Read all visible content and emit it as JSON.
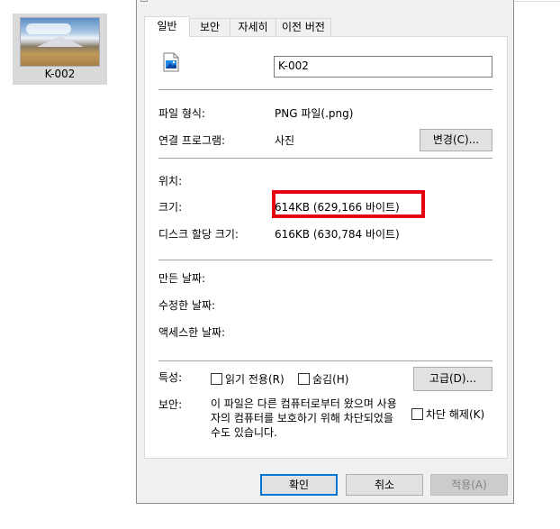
{
  "explorer": {
    "file_label": "K-002"
  },
  "tabs": [
    {
      "label": "일반",
      "active": true
    },
    {
      "label": "보안"
    },
    {
      "label": "자세히"
    },
    {
      "label": "이전 버전"
    }
  ],
  "general": {
    "file_name": "K-002",
    "file_type_label": "파일 형식:",
    "file_type_value": "PNG 파일(.png)",
    "opens_with_label": "연결 프로그램:",
    "opens_with_value": "사진",
    "change_button": "변경(C)...",
    "location_label": "위치:",
    "size_label": "크기:",
    "size_value": "614KB (629,166 바이트)",
    "size_on_disk_label": "디스크 할당 크기:",
    "size_on_disk_value": "616KB (630,784 바이트)",
    "created_label": "만든 날짜:",
    "modified_label": "수정한 날짜:",
    "accessed_label": "액세스한 날짜:",
    "attributes_label": "특성:",
    "readonly_label": "읽기 전용(R)",
    "hidden_label": "숨김(H)",
    "advanced_button": "고급(D)...",
    "security_label": "보안:",
    "security_text": "이 파일은 다른 컴퓨터로부터 왔으며 사용자의 컴퓨터를 보호하기 위해 차단되었을 수도 있습니다.",
    "unblock_label": "차단 해제(K)"
  },
  "footer": {
    "ok": "확인",
    "cancel": "취소",
    "apply": "적용(A)"
  },
  "colors": {
    "highlight": "#e60012",
    "default_button_border": "#0078d7",
    "dialog_bg": "#f0f0f0"
  }
}
